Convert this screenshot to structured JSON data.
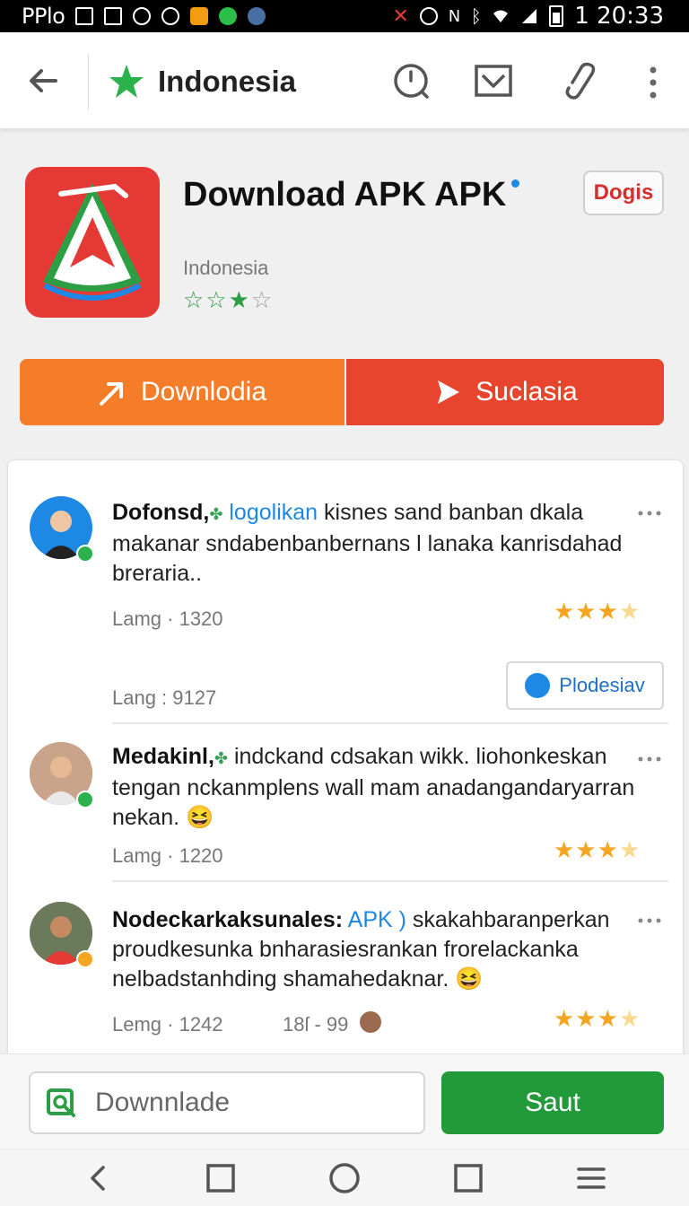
{
  "status_bar": {
    "left_text": "PPlo",
    "time": "1 20:33"
  },
  "toolbar": {
    "title": "Indonesia"
  },
  "app": {
    "name": "Download APK APK",
    "region": "Indonesia",
    "rating_stars": 3,
    "tag_label": "Dogis"
  },
  "actions": {
    "primary_label": "Downlodia",
    "secondary_label": "Suclasia"
  },
  "reviews": [
    {
      "author": "Dofonsd,",
      "highlight": "logolikan",
      "text": "kisnes sand banban dkala makanar sndabenbanbernans l lanaka kanrisdahad breraria..",
      "meta1": "Lamg · 1320",
      "meta2": "Lang : 9127",
      "action_label": "Plodesiav"
    },
    {
      "author": "Medakinl,",
      "text": "indckand cdsakan wikk. liohonkeskan tengan nckanmplens wall mam anadangandaryarran nekan.",
      "emoji": "😆",
      "meta1": "Lamg · 1220"
    },
    {
      "author": "Nodeckarkaksunales:",
      "highlight": "APK )",
      "text": "skakahbaranperkan proudkesunka bnharasiesrankan frorelackanka nelbadstanhding shamahedaknar.",
      "emoji": "😆",
      "meta1": "Lemg · 1242",
      "meta2": "18ſ - 99"
    }
  ],
  "bottom": {
    "download_placeholder": "Downnlade",
    "save_label": "Saut"
  },
  "colors": {
    "accent_green": "#229a3a",
    "orange": "#f57c28",
    "red": "#e8452f",
    "star": "#f4a623",
    "link_blue": "#1e88e5"
  }
}
